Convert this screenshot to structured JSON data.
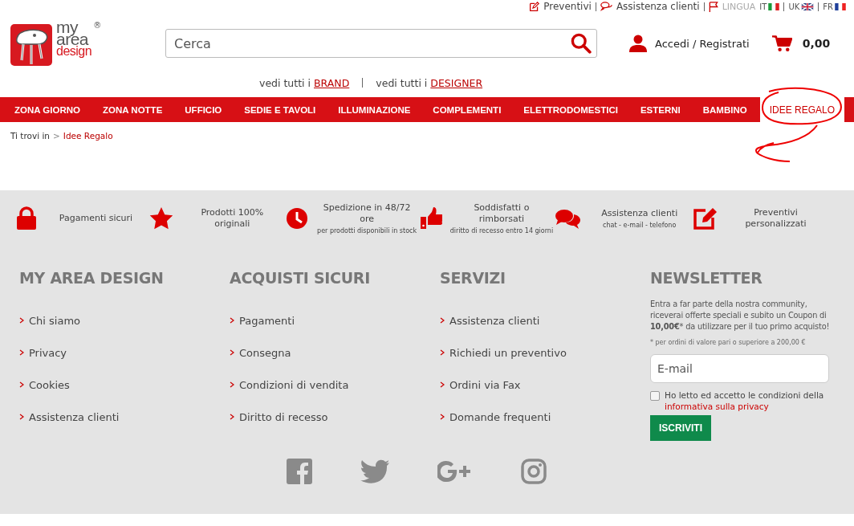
{
  "top_links": [
    {
      "kind": "quote",
      "label": "Preventivi"
    },
    {
      "kind": "support",
      "label": "Assistenza clienti"
    },
    {
      "kind": "language",
      "label": "LINGUA"
    }
  ],
  "logo": {
    "lines": [
      "my",
      "area",
      "design"
    ],
    "mark": "®"
  },
  "languages": [
    {
      "code": "IT",
      "kind": "it"
    },
    {
      "code": "UK",
      "kind": "uk"
    },
    {
      "code": "FR",
      "kind": "fr"
    }
  ],
  "search": {
    "placeholder": "Cerca"
  },
  "account": {
    "label": "Accedi / Registrati"
  },
  "cart": {
    "total": "0,00"
  },
  "browse_links": [
    {
      "prefix": "vedi tutti i",
      "link": "BRAND"
    },
    {
      "prefix": "vedi tutti i",
      "link": "DESIGNER"
    }
  ],
  "nav": [
    {
      "label": "ZONA GIORNO",
      "selected": false
    },
    {
      "label": "ZONA NOTTE",
      "selected": false
    },
    {
      "label": "UFFICIO",
      "selected": false
    },
    {
      "label": "SEDIE E TAVOLI",
      "selected": false
    },
    {
      "label": "ILLUMINAZIONE",
      "selected": false
    },
    {
      "label": "COMPLEMENTI",
      "selected": false
    },
    {
      "label": "ELETTRODOMESTICI",
      "selected": false
    },
    {
      "label": "ESTERNI",
      "selected": false
    },
    {
      "label": "BAMBINO",
      "selected": false
    },
    {
      "label": "IDEE REGALO",
      "selected": true
    }
  ],
  "breadcrumb": {
    "label": "Ti trovi in",
    "separator": ">",
    "current": "Idee Regalo"
  },
  "features": [
    {
      "kind": "lock",
      "title": "Pagamenti sicuri"
    },
    {
      "kind": "star",
      "title": "Prodotti 100% originali"
    },
    {
      "kind": "clock",
      "title": "Spedizione in 48/72 ore",
      "subtitle": "per prodotti disponibili in stock"
    },
    {
      "kind": "thumb",
      "title": "Soddisfatti o rimborsati",
      "subtitle": "diritto di recesso entro 14 giorni"
    },
    {
      "kind": "chat",
      "title": "Assistenza clienti",
      "subtitle": "chat - e-mail - telefono"
    },
    {
      "kind": "edit",
      "title": "Preventivi personalizzati"
    }
  ],
  "footer_columns": [
    {
      "title": "MY AREA DESIGN",
      "links": [
        "Chi siamo",
        "Privacy",
        "Cookies",
        "Assistenza clienti"
      ]
    },
    {
      "title": "ACQUISTI SICURI",
      "links": [
        "Pagamenti",
        "Consegna",
        "Condizioni di vendita",
        "Diritto di recesso"
      ]
    },
    {
      "title": "SERVIZI",
      "links": [
        "Assistenza clienti",
        "Richiedi un preventivo",
        "Ordini via Fax",
        "Domande frequenti"
      ]
    }
  ],
  "newsletter": {
    "title": "NEWSLETTER",
    "text": "Entra a far parte della nostra community, riceverai offerte speciali e subito un Coupon di **10,00€*** da utilizzare per il tuo primo acquisto!",
    "note": "* per ordini di valore pari o superiore a 200,00 €",
    "email_placeholder": "E-mail",
    "consent": {
      "checked": false,
      "text": "Ho letto ed accetto le condizioni della",
      "link": "informativa sulla privacy"
    },
    "button": "ISCRIVITI"
  },
  "social": [
    {
      "kind": "facebook"
    },
    {
      "kind": "twitter"
    },
    {
      "kind": "googleplus"
    },
    {
      "kind": "instagram"
    }
  ]
}
